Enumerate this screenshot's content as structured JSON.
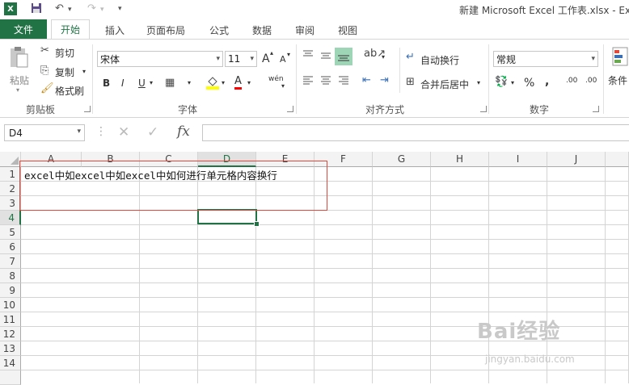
{
  "window": {
    "app_logo": "X",
    "title": "新建 Microsoft Excel 工作表.xlsx - Ex",
    "quick_access": {
      "save_icon": "save-icon",
      "undo_icon": "undo-icon",
      "redo_icon": "redo-icon",
      "customize_icon": "dropdown-icon"
    }
  },
  "tabs": [
    "文件",
    "开始",
    "插入",
    "页面布局",
    "公式",
    "数据",
    "审阅",
    "视图"
  ],
  "ribbon": {
    "clipboard": {
      "paste": "粘贴",
      "cut": "剪切",
      "copy": "复制",
      "format_painter": "格式刷",
      "label": "剪贴板"
    },
    "font": {
      "name": "宋体",
      "size": "11",
      "label": "字体",
      "bold": "B",
      "italic": "I",
      "underline": "U",
      "grow": "A",
      "shrink": "A",
      "phonetic": "wén",
      "font_color": "A"
    },
    "alignment": {
      "wrap_text": "自动换行",
      "merge_center": "合并后居中",
      "label": "对齐方式"
    },
    "number": {
      "format": "常规",
      "percent": "%",
      "comma": ",",
      "label": "数字",
      "inc_decimal": ".00",
      "dec_decimal": ".00"
    },
    "styles": {
      "conditional": "条件"
    }
  },
  "formula_bar": {
    "name_box": "D4",
    "fx": "fx",
    "cancel": "✕",
    "enter": "✓",
    "value": ""
  },
  "grid": {
    "columns": [
      "A",
      "B",
      "C",
      "D",
      "E",
      "F",
      "G",
      "H",
      "I",
      "J"
    ],
    "rows": [
      "1",
      "2",
      "3",
      "4",
      "5",
      "6",
      "7",
      "8",
      "9",
      "10",
      "11",
      "12",
      "13",
      "14"
    ],
    "cell_A1": "excel中如excel中如excel中如何进行单元格内容换行",
    "selected_cell": "D4"
  },
  "watermark": {
    "brand": "Bai经验",
    "url": "jingyan.baidu.com"
  },
  "colors": {
    "excel_green": "#217346",
    "highlight_red": "#e0483c"
  }
}
